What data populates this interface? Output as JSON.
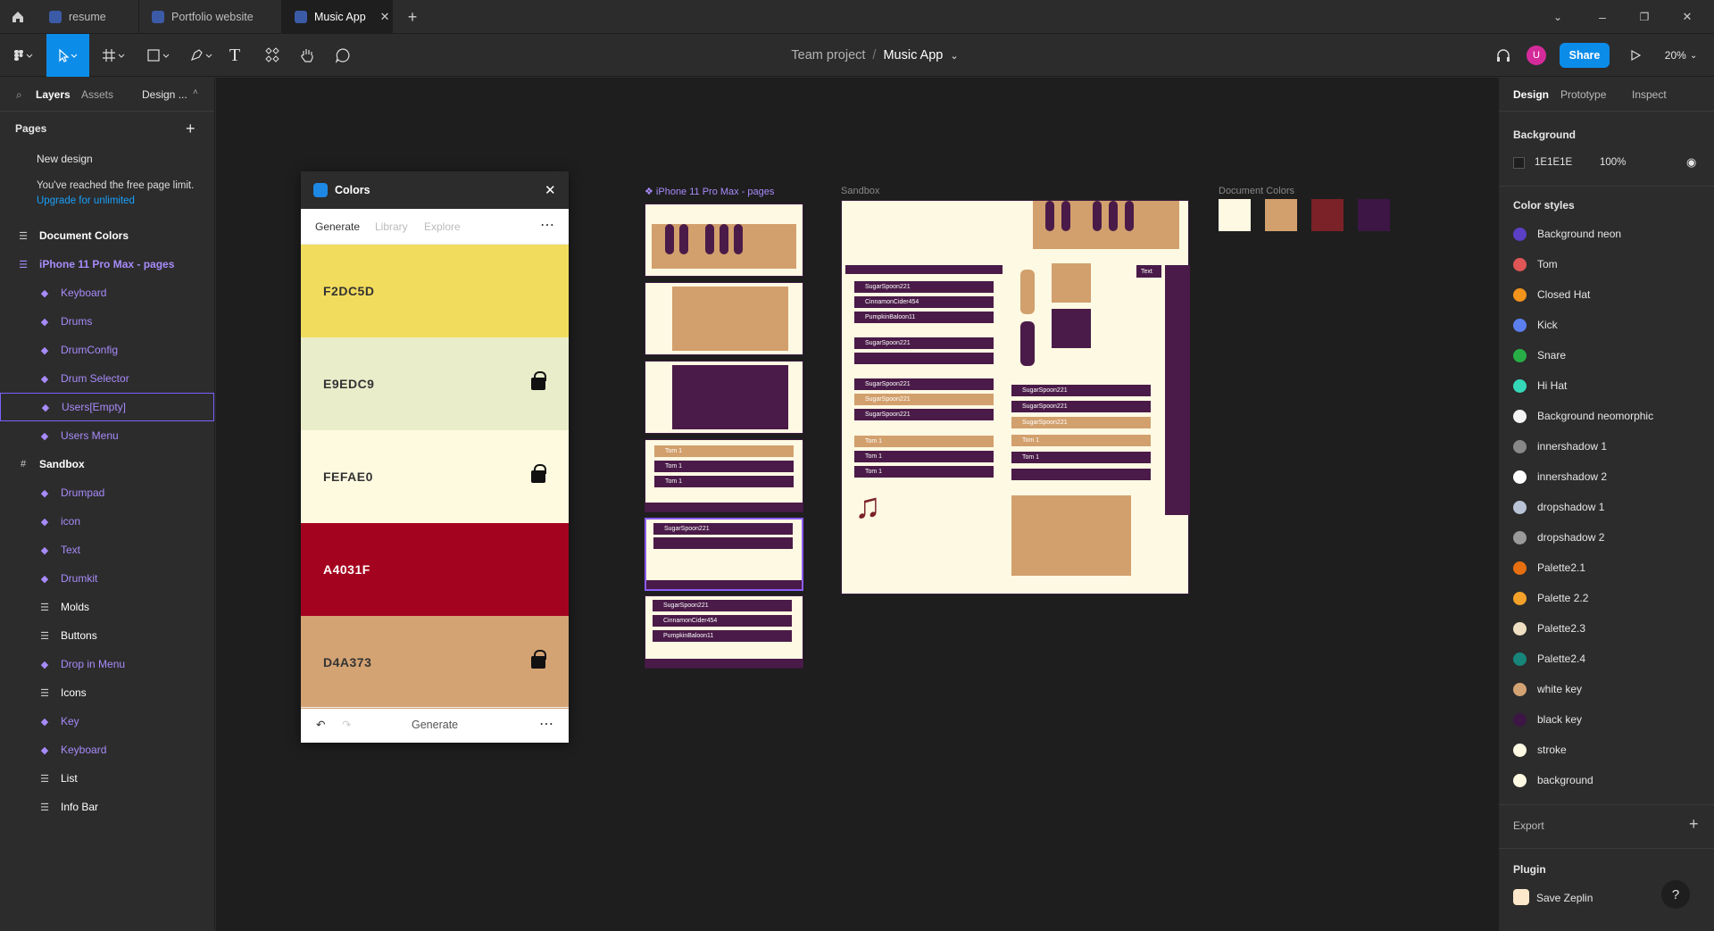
{
  "tabs": [
    {
      "label": "resume"
    },
    {
      "label": "Portfolio website"
    },
    {
      "label": "Music App"
    }
  ],
  "toolbar": {
    "breadcrumb_team": "Team project",
    "breadcrumb_sep": "/",
    "file_name": "Music App",
    "share": "Share",
    "zoom": "20%",
    "avatar": "U"
  },
  "left": {
    "tab_layers": "Layers",
    "tab_assets": "Assets",
    "tab_design": "Design ...",
    "pages_title": "Pages",
    "page_new_design": "New design",
    "limit_text": "You've reached the free page limit.",
    "upgrade": "Upgrade for unlimited",
    "layers": [
      {
        "label": "Document Colors",
        "icon": "frame-icon"
      },
      {
        "label": "iPhone 11 Pro Max - pages",
        "icon": "frame-icon"
      },
      {
        "label": "Keyboard",
        "icon": "component-icon"
      },
      {
        "label": "Drums",
        "icon": "component-icon"
      },
      {
        "label": "DrumConfig",
        "icon": "component-icon"
      },
      {
        "label": "Drum Selector",
        "icon": "component-icon"
      },
      {
        "label": "Users[Empty]",
        "icon": "component-icon"
      },
      {
        "label": "Users Menu",
        "icon": "component-icon"
      },
      {
        "label": "Sandbox",
        "icon": "grid-icon"
      },
      {
        "label": "Drumpad",
        "icon": "component-icon"
      },
      {
        "label": "icon",
        "icon": "component-icon"
      },
      {
        "label": "Text",
        "icon": "component-icon"
      },
      {
        "label": "Drumkit",
        "icon": "component-icon"
      },
      {
        "label": "Molds",
        "icon": "list-icon"
      },
      {
        "label": "Buttons",
        "icon": "list-icon"
      },
      {
        "label": "Drop in Menu",
        "icon": "component-icon"
      },
      {
        "label": "Icons",
        "icon": "list-icon"
      },
      {
        "label": "Key",
        "icon": "component-icon"
      },
      {
        "label": "Keyboard",
        "icon": "component-icon"
      },
      {
        "label": "List",
        "icon": "list-icon"
      },
      {
        "label": "Info Bar",
        "icon": "list-icon"
      }
    ]
  },
  "coolors": {
    "title": "Colors",
    "tabs": [
      "Generate",
      "Library",
      "Explore"
    ],
    "swatches": [
      {
        "hex": "F2DC5D",
        "color": "#F2DC5D",
        "locked": false
      },
      {
        "hex": "E9EDC9",
        "color": "#E9EDC9",
        "locked": true
      },
      {
        "hex": "FEFAE0",
        "color": "#FEFAE0",
        "locked": true
      },
      {
        "hex": "A4031F",
        "color": "#A4031F",
        "locked": false
      },
      {
        "hex": "D4A373",
        "color": "#D4A373",
        "locked": true
      }
    ],
    "generate": "Generate"
  },
  "canvas": {
    "frame_iphone": "iPhone 11 Pro Max - pages",
    "frame_sandbox": "Sandbox",
    "frame_doccolors": "Document Colors",
    "doc_colors": [
      "#fef9e3",
      "#d2a06d",
      "#7a2228",
      "#3d1646"
    ],
    "items": {
      "s1": "SugarSpoon221",
      "c1": "CinnamonCider454",
      "p1": "PumpkinBaloon11",
      "tom": "Tom 1",
      "text": "Text"
    }
  },
  "right": {
    "tabs": [
      "Design",
      "Prototype",
      "Inspect"
    ],
    "background_title": "Background",
    "bg_hex": "1E1E1E",
    "bg_opacity": "100%",
    "color_styles_title": "Color styles",
    "styles": [
      {
        "name": "Background neon",
        "color": "#5b3fc4"
      },
      {
        "name": "Tom",
        "color": "#e05656"
      },
      {
        "name": "Closed Hat",
        "color": "#f2931b"
      },
      {
        "name": "Kick",
        "color": "#5c7ff0"
      },
      {
        "name": "Snare",
        "color": "#27ae46"
      },
      {
        "name": "Hi Hat",
        "color": "#34d8b8"
      },
      {
        "name": "Background neomorphic",
        "color": "#f4f4f4"
      },
      {
        "name": "innershadow 1",
        "color": "#888888"
      },
      {
        "name": "innershadow 2",
        "color": "#ffffff"
      },
      {
        "name": "dropshadow 1",
        "color": "#b8c4d6"
      },
      {
        "name": "dropshadow 2",
        "color": "#9a9a9a"
      },
      {
        "name": "Palette2.1",
        "color": "#e76f10"
      },
      {
        "name": "Palette 2.2",
        "color": "#f4a12a"
      },
      {
        "name": "Palette2.3",
        "color": "#efe0c4"
      },
      {
        "name": "Palette2.4",
        "color": "#17857a"
      },
      {
        "name": "white key",
        "color": "#d4a373"
      },
      {
        "name": "black key",
        "color": "#3d1646"
      },
      {
        "name": "stroke",
        "color": "#fef9e3"
      },
      {
        "name": "background",
        "color": "#fef9e3"
      }
    ],
    "export": "Export",
    "plugin_title": "Plugin",
    "plugin_name": "Save Zeplin"
  }
}
